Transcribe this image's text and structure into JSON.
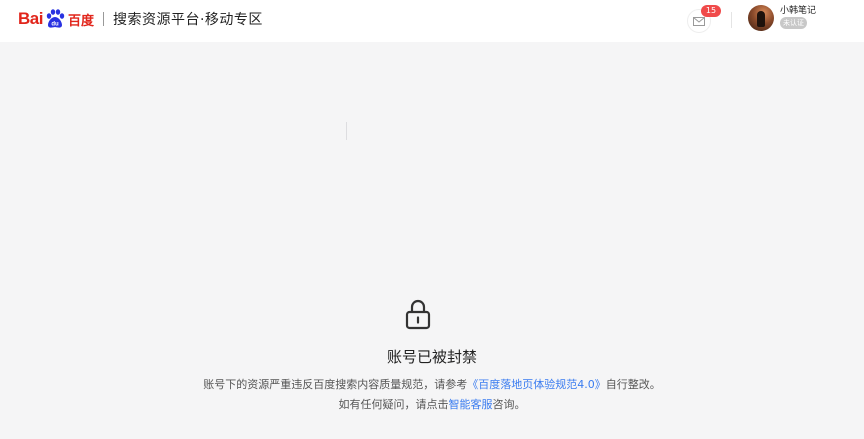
{
  "header": {
    "logo": {
      "bai": "Bai",
      "du": "du",
      "cn": "百度"
    },
    "title": "搜索资源平台·移动专区",
    "mail_badge": "15",
    "user": {
      "name": "小韩笔记",
      "status": "未认证"
    }
  },
  "main": {
    "icon": "lock-icon",
    "title": "账号已被封禁",
    "line1_pre": "账号下的资源严重违反百度搜索内容质量规范，请参考",
    "line1_link": "《百度落地页体验规范4.0》",
    "line1_post": "自行整改。",
    "line2_pre": "如有任何疑问，请点击",
    "line2_link": "智能客服",
    "line2_post": "咨询。"
  },
  "colors": {
    "brand_red": "#e1251b",
    "link_blue": "#3a7cf0",
    "badge_red": "#f04a4a"
  }
}
